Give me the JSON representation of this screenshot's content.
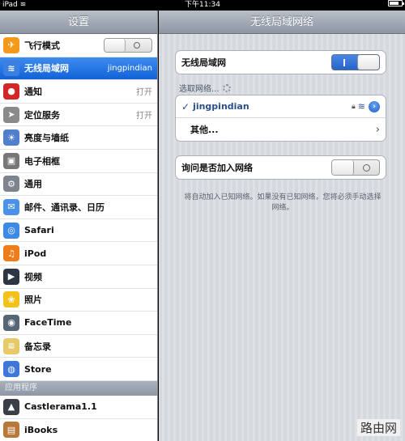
{
  "status": {
    "device": "iPad",
    "time": "下午11:34",
    "battery": 0.75
  },
  "sidebar": {
    "title": "设置",
    "items": [
      {
        "label": "飞行模式",
        "icon": "airplane-icon",
        "color": "#f39a1b",
        "glyph": "✈"
      },
      {
        "label": "无线局域网",
        "value": "jingpindian",
        "icon": "wifi-icon",
        "color": "#3b7fe0",
        "glyph": "≋"
      },
      {
        "label": "通知",
        "value": "打开",
        "icon": "notifications-icon",
        "color": "#d32626",
        "glyph": "●"
      },
      {
        "label": "定位服务",
        "value": "打开",
        "icon": "location-icon",
        "color": "#8a8a8a",
        "glyph": "➤"
      },
      {
        "label": "亮度与墙纸",
        "icon": "brightness-icon",
        "color": "#4f80c9",
        "glyph": "☀"
      },
      {
        "label": "电子相框",
        "icon": "picture-frame-icon",
        "color": "#777777",
        "glyph": "▣"
      },
      {
        "label": "通用",
        "icon": "general-gear-icon",
        "color": "#7d848d",
        "glyph": "⚙"
      },
      {
        "label": "邮件、通讯录、日历",
        "icon": "mail-icon",
        "color": "#4b92e6",
        "glyph": "✉"
      },
      {
        "label": "Safari",
        "icon": "safari-icon",
        "color": "#3d8ae6",
        "glyph": "◎"
      },
      {
        "label": "iPod",
        "icon": "ipod-icon",
        "color": "#f07d1a",
        "glyph": "♫"
      },
      {
        "label": "视频",
        "icon": "video-icon",
        "color": "#2d3642",
        "glyph": "▶"
      },
      {
        "label": "照片",
        "icon": "photos-icon",
        "color": "#f2c21b",
        "glyph": "❀"
      },
      {
        "label": "FaceTime",
        "icon": "facetime-icon",
        "color": "#556677",
        "glyph": "◉"
      },
      {
        "label": "备忘录",
        "icon": "notes-icon",
        "color": "#e8c96a",
        "glyph": "≡"
      },
      {
        "label": "Store",
        "icon": "store-icon",
        "color": "#3d78d8",
        "glyph": "◍"
      }
    ],
    "section_apps": "应用程序",
    "apps": [
      {
        "label": "Castlerama1.1",
        "icon": "castlerama-icon",
        "color": "#3a3f46",
        "glyph": "▲"
      },
      {
        "label": "iBooks",
        "icon": "ibooks-icon",
        "color": "#b7783a",
        "glyph": "▤"
      }
    ]
  },
  "main": {
    "title": "无线局域网络",
    "wifi_label": "无线局域网",
    "wifi_on_mark": "I",
    "choose_label": "选取网络...",
    "network_name": "jingpindian",
    "other_label": "其他...",
    "ask_label": "询问是否加入网络",
    "hint": "将自动加入已知网络。如果没有已知网络，您将必须手动选择网络。"
  },
  "watermark": "路由网"
}
